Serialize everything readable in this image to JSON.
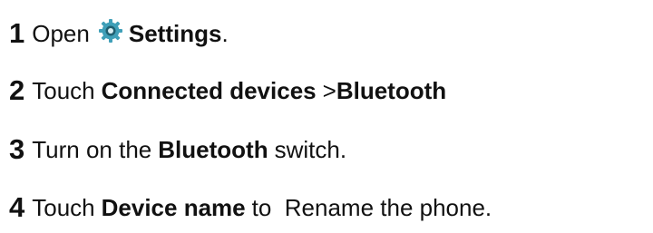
{
  "steps": [
    {
      "number": "1",
      "text_before": "Open",
      "icon": "settings-gear-icon",
      "bold": "Settings",
      "text_after": "."
    },
    {
      "number": "2",
      "text_before": "Touch",
      "bold": "Connected devices",
      "separator": ">",
      "bold2": "Bluetooth"
    },
    {
      "number": "3",
      "text_before": "Turn on the",
      "bold": "Bluetooth",
      "text_after": "switch."
    },
    {
      "number": "4",
      "text_before": "Touch",
      "bold": "Device name",
      "text_after": "to  Rename the phone."
    }
  ],
  "colors": {
    "text": "#111111",
    "icon_gear": "#3f9fb8",
    "icon_center": "#1f5f70"
  }
}
